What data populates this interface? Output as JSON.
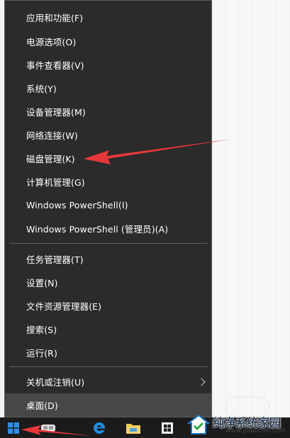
{
  "menu": {
    "items": [
      {
        "label": "应用和功能(F)"
      },
      {
        "label": "电源选项(O)"
      },
      {
        "label": "事件查看器(V)"
      },
      {
        "label": "系统(Y)"
      },
      {
        "label": "设备管理器(M)"
      },
      {
        "label": "网络连接(W)"
      },
      {
        "label": "磁盘管理(K)"
      },
      {
        "label": "计算机管理(G)"
      },
      {
        "label": "Windows PowerShell(I)"
      },
      {
        "label": "Windows PowerShell (管理员)(A)"
      },
      {
        "label": "任务管理器(T)"
      },
      {
        "label": "设置(N)"
      },
      {
        "label": "文件资源管理器(E)"
      },
      {
        "label": "搜索(S)"
      },
      {
        "label": "运行(R)"
      },
      {
        "label": "关机或注销(U)"
      },
      {
        "label": "桌面(D)"
      }
    ]
  },
  "watermark": {
    "title": "纯净系统家园",
    "url": "www.yidaimei.com"
  },
  "colors": {
    "menu_bg": "#2b2b2b",
    "menu_text": "#ffffff",
    "separator": "#5c5c5c",
    "taskbar": "#1b1b1b",
    "arrow": "#e8373b",
    "accent": "#0078d7"
  }
}
